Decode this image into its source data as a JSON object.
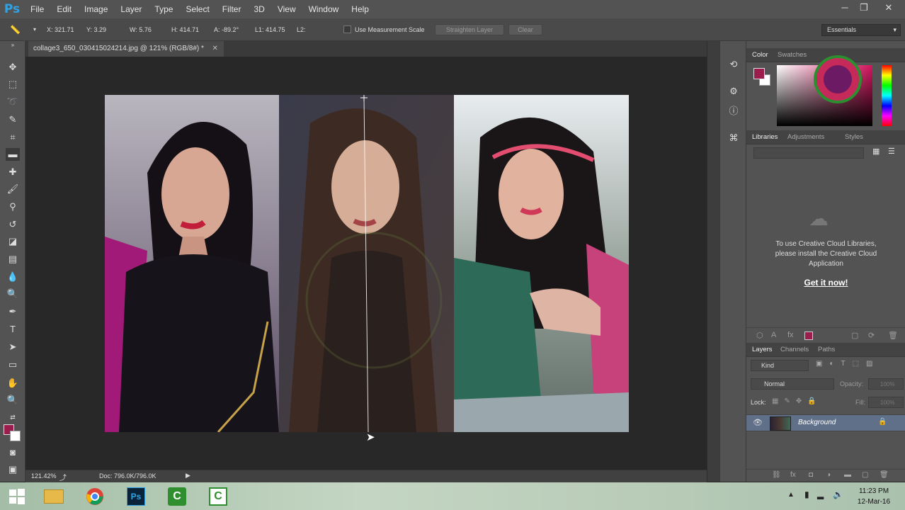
{
  "app": {
    "logo": "Ps"
  },
  "menu": [
    "File",
    "Edit",
    "Image",
    "Layer",
    "Type",
    "Select",
    "Filter",
    "3D",
    "View",
    "Window",
    "Help"
  ],
  "window_controls": {
    "minimize": "─",
    "maximize": "❐",
    "close": "✕"
  },
  "options_bar": {
    "x": "X: 321.71",
    "y": "Y: 3.29",
    "w": "W: 5.76",
    "h": "H: 414.71",
    "a": "A: -89.2°",
    "l1": "L1: 414.75",
    "l2": "L2:",
    "use_measurement_scale": "Use Measurement Scale",
    "straighten_layer": "Straighten Layer",
    "clear": "Clear",
    "workspace": "Essentials"
  },
  "document": {
    "tab_title": "collage3_650_030415024214.jpg @ 121% (RGB/8#) *",
    "close": "✕"
  },
  "status": {
    "zoom": "121.42%",
    "doc": "Doc: 796.0K/796.0K"
  },
  "color_panel": {
    "tabs": [
      "Color",
      "Swatches"
    ],
    "fg_color": "#9b1d4e",
    "bg_color": "#ffffff"
  },
  "libraries_panel": {
    "tabs": [
      "Libraries",
      "Adjustments",
      "Styles"
    ],
    "message": [
      "To use Creative Cloud Libraries,",
      "please install the Creative Cloud",
      "Application"
    ],
    "link": "Get it now!"
  },
  "layers_panel": {
    "tabs": [
      "Layers",
      "Channels",
      "Paths"
    ],
    "filter": "Kind",
    "blend_mode": "Normal",
    "opacity_label": "Opacity:",
    "opacity": "100%",
    "lock_label": "Lock:",
    "fill_label": "Fill:",
    "fill": "100%",
    "layer_name": "Background"
  },
  "taskbar": {
    "time": "11:23 PM",
    "date": "12-Mar-16"
  }
}
